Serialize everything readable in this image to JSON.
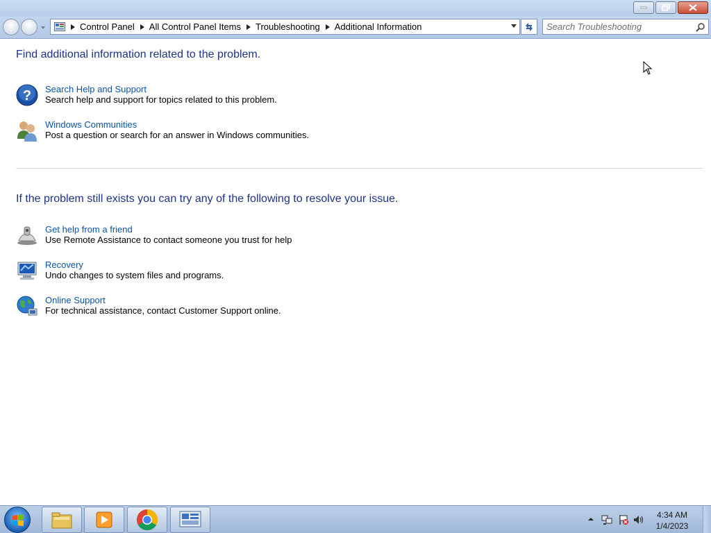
{
  "breadcrumb": [
    {
      "label": "Control Panel"
    },
    {
      "label": "All Control Panel Items"
    },
    {
      "label": "Troubleshooting"
    },
    {
      "label": "Additional Information"
    }
  ],
  "search": {
    "placeholder": "Search Troubleshooting"
  },
  "section1": {
    "heading": "Find additional information related to the problem.",
    "items": [
      {
        "link": "Search Help and Support",
        "desc": "Search help and support for topics related to this problem.",
        "icon": "help-question-icon"
      },
      {
        "link": "Windows Communities",
        "desc": "Post a question or search for an answer in Windows communities.",
        "icon": "users-icon"
      }
    ]
  },
  "section2": {
    "heading": "If the problem still exists you can try any of the following to resolve your issue.",
    "items": [
      {
        "link": "Get help from a friend",
        "desc": "Use Remote Assistance to contact someone you trust for help",
        "icon": "remote-assistance-icon"
      },
      {
        "link": "Recovery",
        "desc": "Undo changes to system files and programs.",
        "icon": "recovery-icon"
      },
      {
        "link": "Online Support",
        "desc": "For technical assistance, contact Customer Support online.",
        "icon": "globe-icon"
      }
    ]
  },
  "taskbar": {
    "apps": [
      "file-explorer-icon",
      "media-player-icon",
      "chrome-icon",
      "control-panel-icon"
    ],
    "clock": {
      "time": "4:34 AM",
      "date": "1/4/2023"
    }
  },
  "colors": {
    "heading": "#1e3287",
    "link": "#0c54a8"
  }
}
